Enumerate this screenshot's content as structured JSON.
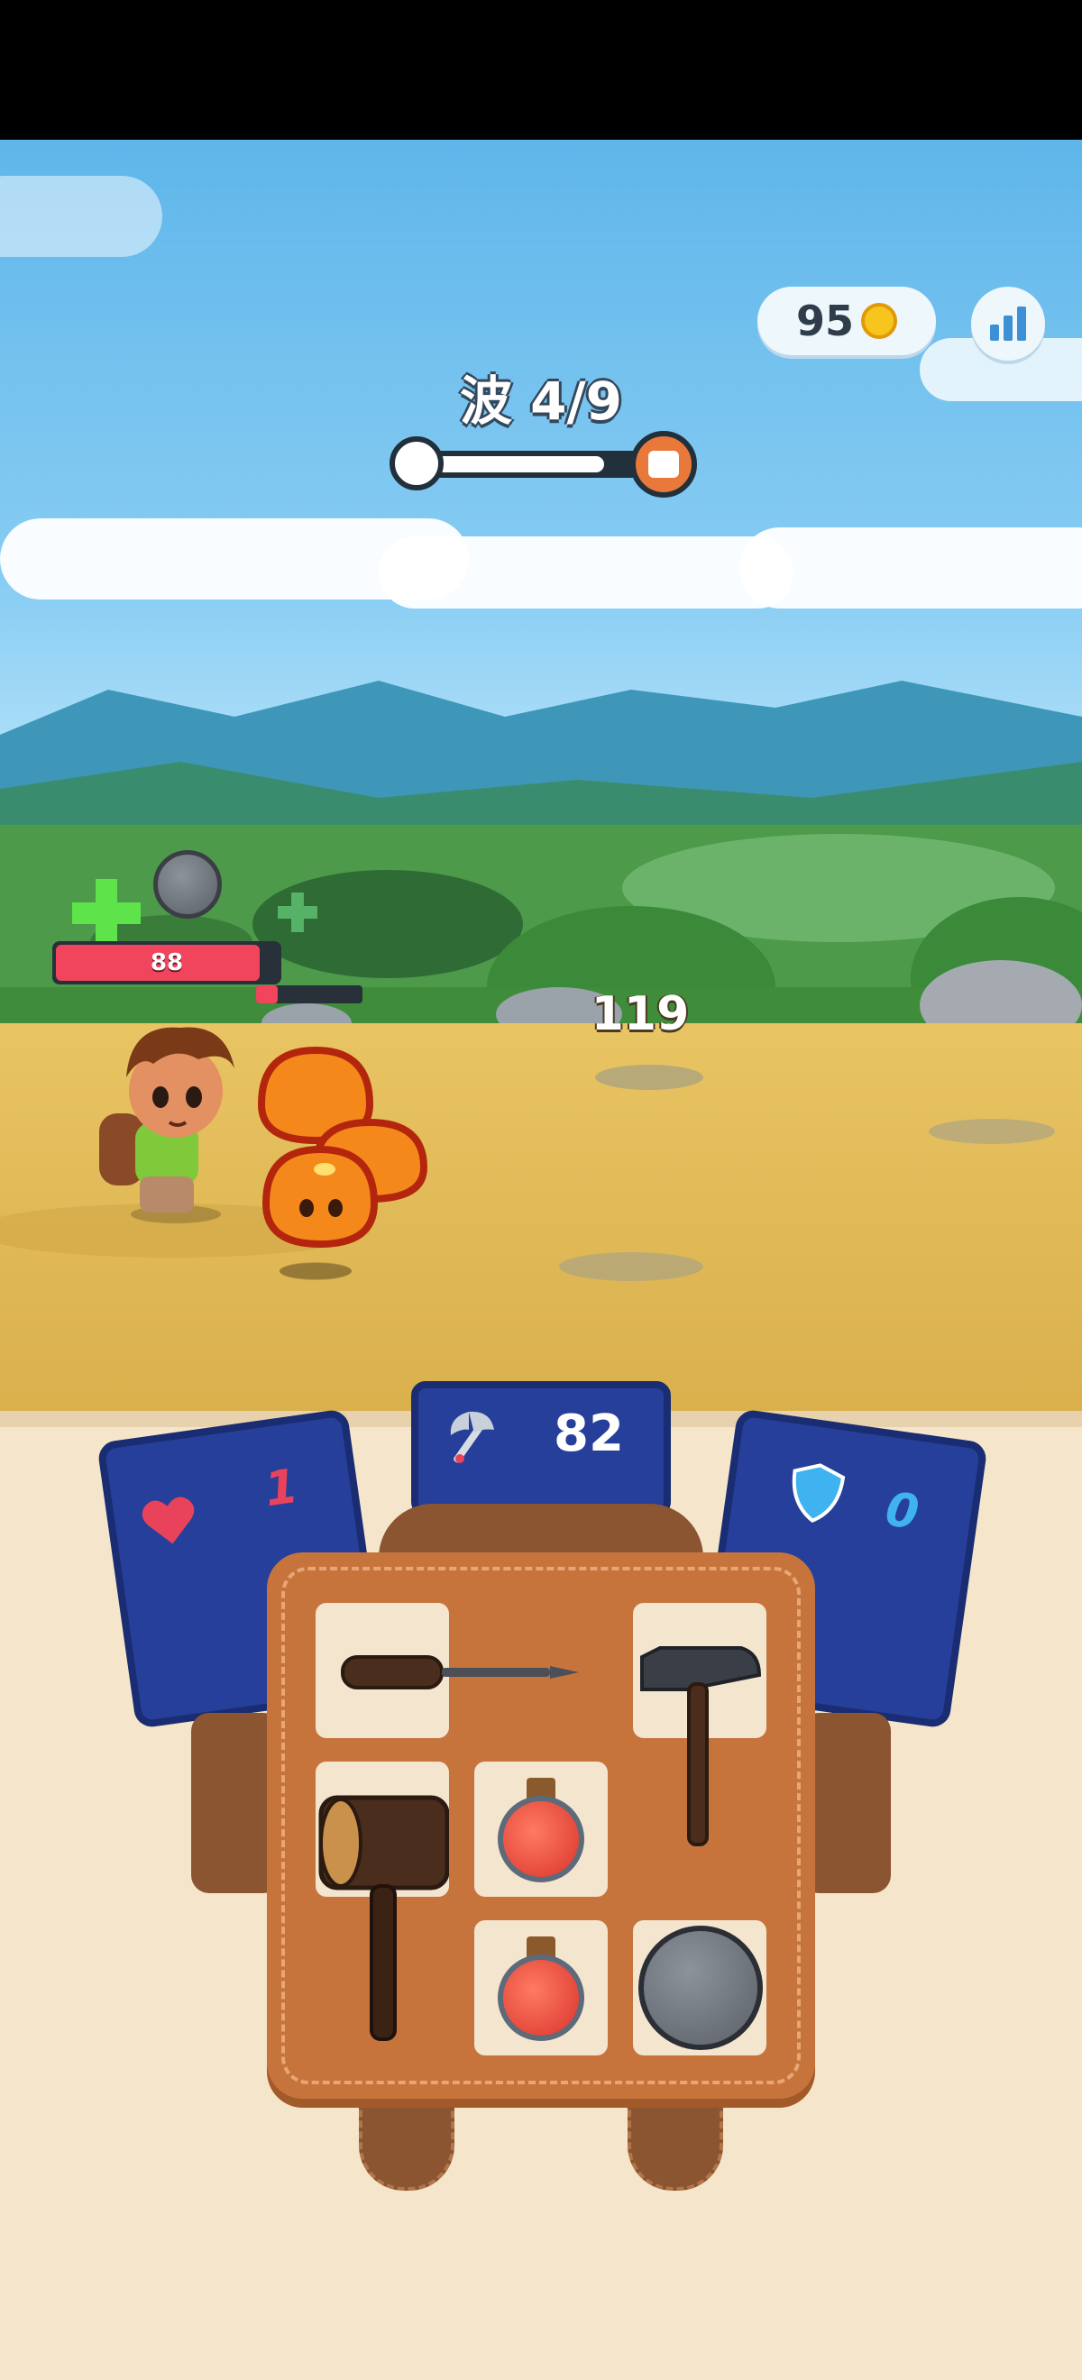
{
  "hud": {
    "coins": "95",
    "wave_label": "波 4/9",
    "wave_current": 4,
    "wave_total": 9,
    "wave_progress": 0.78,
    "player_hp": "88",
    "player_hp_fraction": 0.92,
    "enemy_hp_fraction": 0.2,
    "damage_number": "119"
  },
  "stats": {
    "heart_value": "1",
    "attack_value": "82",
    "shield_value": "0"
  },
  "colors": {
    "heart_value": "#e8435a",
    "shield_value": "#3fb2f0",
    "accent_blue": "#263f9a",
    "hp_red": "#f0455d",
    "bag_brown": "#c7743c"
  },
  "inventory": [
    {
      "slot": "1",
      "item": "screwdriver-icon"
    },
    {
      "slot": "2",
      "item": "screwdriver-icon"
    },
    {
      "slot": "3",
      "item": "hammer-icon"
    },
    {
      "slot": "4",
      "item": "wooden-mallet-icon"
    },
    {
      "slot": "5",
      "item": "red-potion-icon"
    },
    {
      "slot": "6",
      "item": "hammer-icon"
    },
    {
      "slot": "7",
      "item": "wooden-mallet-icon"
    },
    {
      "slot": "8",
      "item": "red-potion-icon"
    },
    {
      "slot": "9",
      "item": "stone-ball-icon"
    }
  ]
}
